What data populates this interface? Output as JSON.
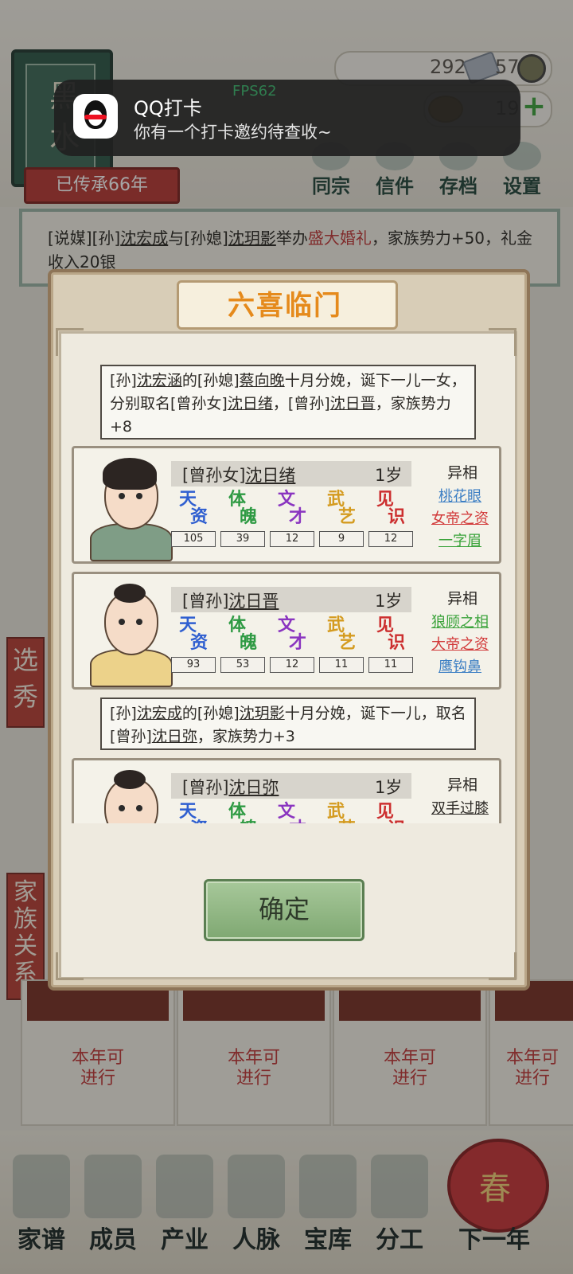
{
  "background": {
    "clan_chars": [
      "黑",
      "水"
    ],
    "heritage": "已传承66年",
    "resources": {
      "silver": "292",
      "coins": "57",
      "gold": "19"
    },
    "top_buttons": [
      "同宗",
      "信件",
      "存档",
      "设置"
    ],
    "log": {
      "part1": "[说媒][孙]",
      "name1": "沈宏成",
      "part2": "与[孙媳]",
      "name2": "沈玥影",
      "part3": "举办",
      "highlight": "盛大婚礼",
      "part4": "，家族势力+50，礼金收入20银"
    },
    "side_tags": [
      "选秀",
      "家族关系"
    ],
    "slot_text": [
      "本年可",
      "进行"
    ],
    "bottom_nav": [
      "家谱",
      "成员",
      "产业",
      "人脉",
      "宝库",
      "分工",
      "下一年"
    ],
    "lantern_char": "春"
  },
  "notification": {
    "title": "QQ打卡",
    "body": "你有一个打卡邀约待查收~",
    "fps": "FPS62"
  },
  "dialog": {
    "title": "六喜临门",
    "ok_button": "确定",
    "events": [
      {
        "text_a": "[孙]",
        "name_a": "沈宏涵",
        "text_b": "的[孙媳]",
        "name_b": "蔡向晚",
        "text_c": "十月分娩，诞下一儿一女，分别取名[曾孙女]",
        "name_c": "沈日绪",
        "text_d": "，[曾孙]",
        "name_d": "沈日晋",
        "text_e": "，家族势力+8"
      },
      {
        "text_a": "[孙]",
        "name_a": "沈宏成",
        "text_b": "的[孙媳]",
        "name_b": "沈玥影",
        "text_c": "十月分娩，诞下一儿，取名[曾孙]",
        "name_c": "沈日弥",
        "text_d": "，家族势力+3"
      }
    ],
    "attr_labels": [
      [
        "天",
        "资"
      ],
      [
        "体",
        "魄"
      ],
      [
        "文",
        "才"
      ],
      [
        "武",
        "艺"
      ],
      [
        "见",
        "识"
      ]
    ],
    "trait_header": "异相",
    "children": [
      {
        "prefix": "[曾孙女]",
        "name": "沈日绪",
        "age": "1岁",
        "stats": [
          "105",
          "39",
          "12",
          "9",
          "12"
        ],
        "traits": [
          {
            "label": "桃花眼",
            "color": "#3d7fc4"
          },
          {
            "label": "女帝之资",
            "color": "#d23a3a"
          },
          {
            "label": "一字眉",
            "color": "#3aa33a"
          }
        ]
      },
      {
        "prefix": "[曾孙]",
        "name": "沈日晋",
        "age": "1岁",
        "stats": [
          "93",
          "53",
          "12",
          "11",
          "11"
        ],
        "traits": [
          {
            "label": "狼顾之相",
            "color": "#3aa33a"
          },
          {
            "label": "大帝之资",
            "color": "#d23a3a"
          },
          {
            "label": "鹰钩鼻",
            "color": "#3d7fc4"
          }
        ]
      },
      {
        "prefix": "[曾孙]",
        "name": "沈日弥",
        "age": "1岁",
        "stats": [
          "",
          "",
          "",
          "",
          ""
        ],
        "traits": [
          {
            "label": "双手过膝",
            "color": "#2d2a26"
          }
        ]
      }
    ]
  },
  "colors": {
    "attr": [
      "#2f5fd0",
      "#2e9a43",
      "#8a35c0",
      "#d49b1f",
      "#cc2f2f"
    ],
    "title_orange": "#e58a1c",
    "red_text": "#c23b3b"
  }
}
